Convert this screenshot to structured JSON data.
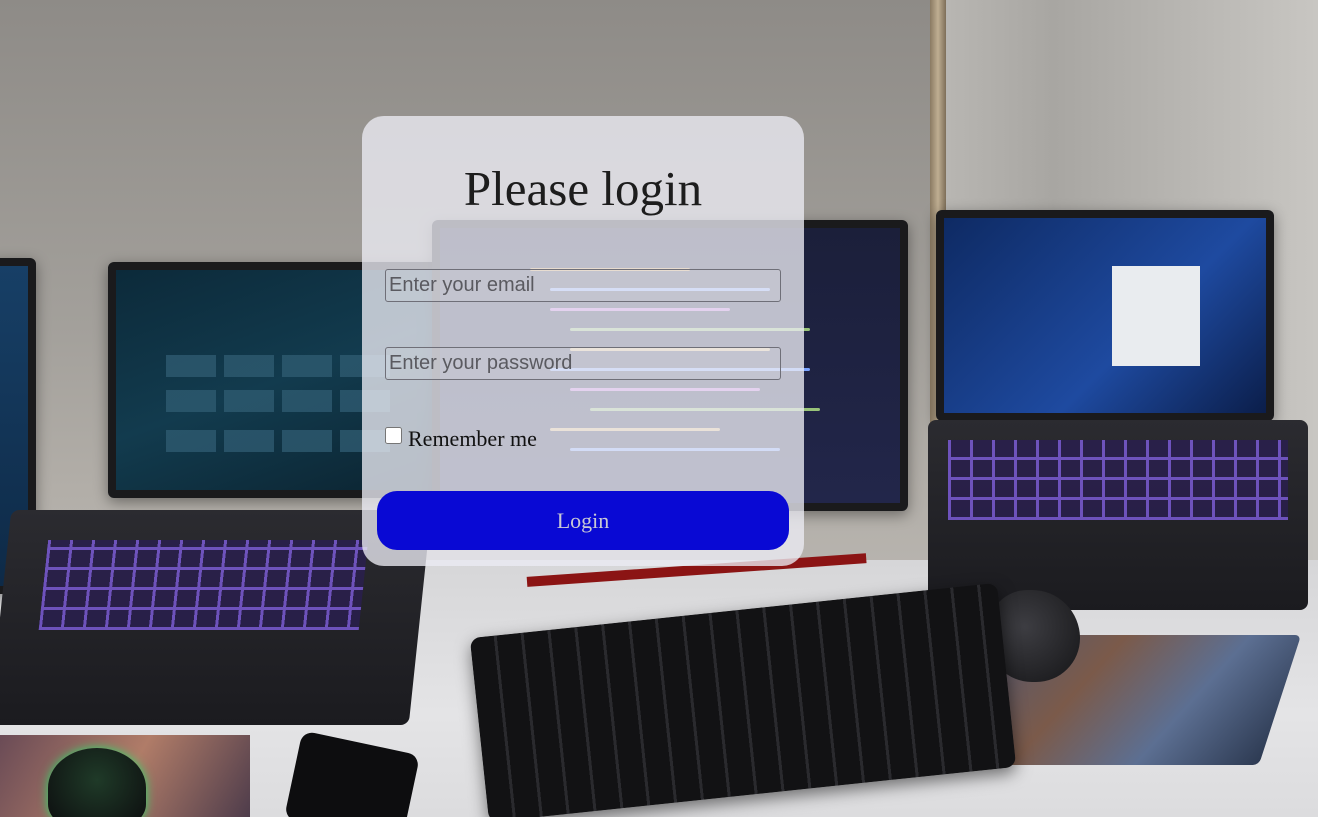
{
  "login": {
    "title": "Please login",
    "email": {
      "value": "",
      "placeholder": "Enter your email"
    },
    "password": {
      "value": "",
      "placeholder": "Enter your password"
    },
    "remember_label": "Remember me",
    "remember_checked": false,
    "submit_label": "Login"
  },
  "colors": {
    "button_bg": "#0909d4",
    "card_bg": "rgba(236,236,244,0.78)"
  },
  "background": {
    "description_icon": "photo-background"
  }
}
